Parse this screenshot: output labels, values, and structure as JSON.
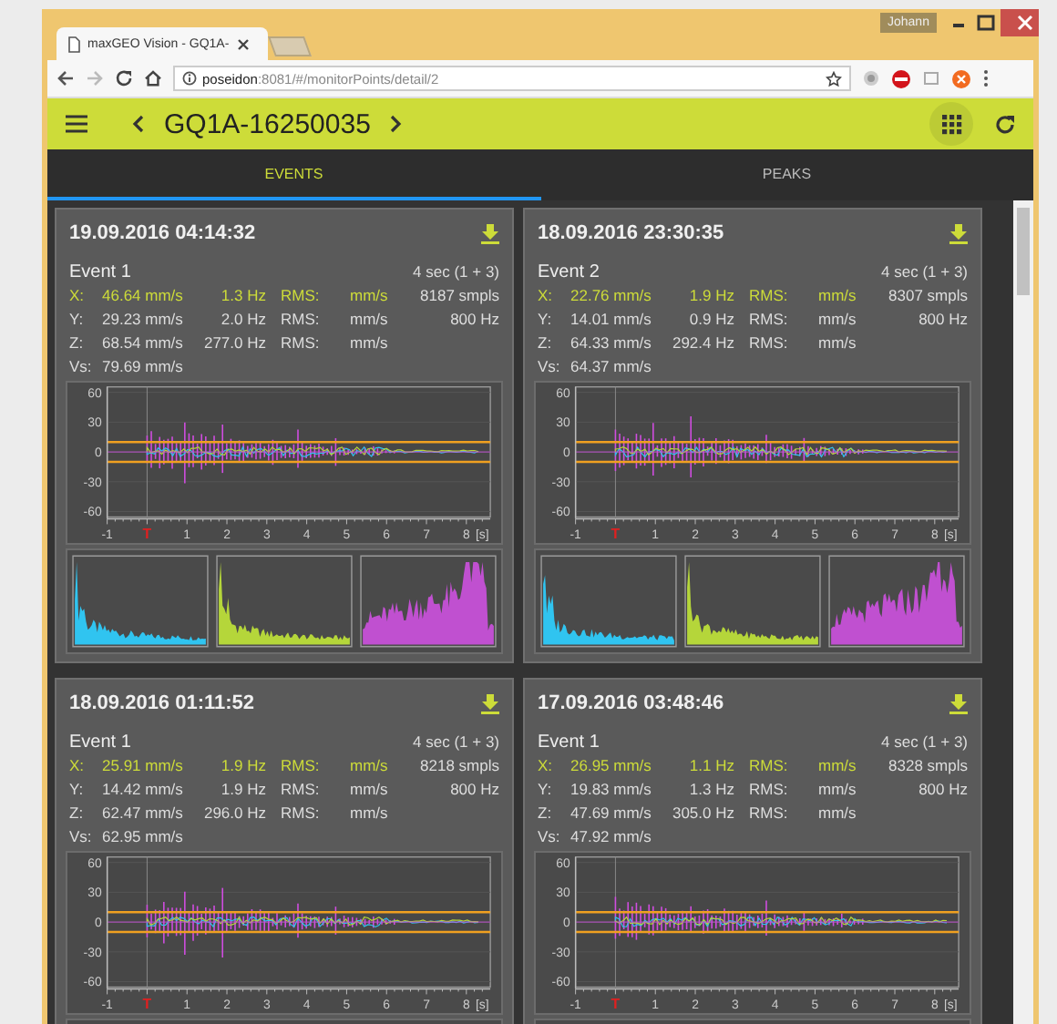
{
  "browser": {
    "tab_title": "maxGEO Vision - GQ1A-",
    "user": "Johann",
    "url_host": "poseidon",
    "url_path": ":8081/#/monitorPoints/detail/2"
  },
  "app_bar": {
    "title": "GQ1A-16250035"
  },
  "tabs": [
    {
      "label": "EVENTS",
      "selected": true
    },
    {
      "label": "PEAKS",
      "selected": false
    }
  ],
  "events": [
    {
      "timestamp": "19.09.2016 04:14:32",
      "name": "Event 1",
      "duration": "4 sec (1 + 3)",
      "axes": [
        {
          "axis": "X:",
          "velocity": "46.64 mm/s",
          "frequency": "1.3 Hz",
          "rms_label": "RMS:",
          "rms_unit": "mm/s",
          "info": "8187 smpls",
          "highlighted": true
        },
        {
          "axis": "Y:",
          "velocity": "29.23 mm/s",
          "frequency": "2.0 Hz",
          "rms_label": "RMS:",
          "rms_unit": "mm/s",
          "info": "800 Hz",
          "highlighted": false
        },
        {
          "axis": "Z:",
          "velocity": "68.54 mm/s",
          "frequency": "277.0 Hz",
          "rms_label": "RMS:",
          "rms_unit": "mm/s",
          "highlighted": false
        }
      ],
      "vs_label": "Vs:",
      "vs": "79.69 mm/s",
      "y_labels": [
        "60",
        "30",
        "0",
        "-30",
        "-60"
      ],
      "x_labels": [
        "-1",
        "T",
        "1",
        "2",
        "3",
        "4",
        "5",
        "6",
        "7",
        "8",
        "[s]"
      ]
    },
    {
      "timestamp": "18.09.2016 23:30:35",
      "name": "Event 2",
      "duration": "4 sec (1 + 3)",
      "axes": [
        {
          "axis": "X:",
          "velocity": "22.76 mm/s",
          "frequency": "1.9 Hz",
          "rms_label": "RMS:",
          "rms_unit": "mm/s",
          "info": "8307 smpls",
          "highlighted": true
        },
        {
          "axis": "Y:",
          "velocity": "14.01 mm/s",
          "frequency": "0.9 Hz",
          "rms_label": "RMS:",
          "rms_unit": "mm/s",
          "info": "800 Hz",
          "highlighted": false
        },
        {
          "axis": "Z:",
          "velocity": "64.33 mm/s",
          "frequency": "292.4 Hz",
          "rms_label": "RMS:",
          "rms_unit": "mm/s",
          "highlighted": false
        }
      ],
      "vs_label": "Vs:",
      "vs": "64.37 mm/s",
      "y_labels": [
        "60",
        "30",
        "0",
        "-30",
        "-60"
      ],
      "x_labels": [
        "-1",
        "T",
        "1",
        "2",
        "3",
        "4",
        "5",
        "6",
        "7",
        "8",
        "[s]"
      ]
    },
    {
      "timestamp": "18.09.2016 01:11:52",
      "name": "Event 1",
      "duration": "4 sec (1 + 3)",
      "axes": [
        {
          "axis": "X:",
          "velocity": "25.91 mm/s",
          "frequency": "1.9 Hz",
          "rms_label": "RMS:",
          "rms_unit": "mm/s",
          "info": "8218 smpls",
          "highlighted": true
        },
        {
          "axis": "Y:",
          "velocity": "14.42 mm/s",
          "frequency": "1.9 Hz",
          "rms_label": "RMS:",
          "rms_unit": "mm/s",
          "info": "800 Hz",
          "highlighted": false
        },
        {
          "axis": "Z:",
          "velocity": "62.47 mm/s",
          "frequency": "296.0 Hz",
          "rms_label": "RMS:",
          "rms_unit": "mm/s",
          "highlighted": false
        }
      ],
      "vs_label": "Vs:",
      "vs": "62.95 mm/s",
      "y_labels": [
        "60",
        "30",
        "0",
        "-30",
        "-60"
      ],
      "x_labels": [
        "-1",
        "T",
        "1",
        "2",
        "3",
        "4",
        "5",
        "6",
        "7",
        "8",
        "[s]"
      ]
    },
    {
      "timestamp": "17.09.2016 03:48:46",
      "name": "Event 1",
      "duration": "4 sec (1 + 3)",
      "axes": [
        {
          "axis": "X:",
          "velocity": "26.95 mm/s",
          "frequency": "1.1 Hz",
          "rms_label": "RMS:",
          "rms_unit": "mm/s",
          "info": "8328 smpls",
          "highlighted": true
        },
        {
          "axis": "Y:",
          "velocity": "19.83 mm/s",
          "frequency": "1.3 Hz",
          "rms_label": "RMS:",
          "rms_unit": "mm/s",
          "info": "800 Hz",
          "highlighted": false
        },
        {
          "axis": "Z:",
          "velocity": "47.69 mm/s",
          "frequency": "305.0 Hz",
          "rms_label": "RMS:",
          "rms_unit": "mm/s",
          "highlighted": false
        }
      ],
      "vs_label": "Vs:",
      "vs": "47.92 mm/s",
      "y_labels": [
        "60",
        "30",
        "0",
        "-30",
        "-60"
      ],
      "x_labels": [
        "-1",
        "T",
        "1",
        "2",
        "3",
        "4",
        "5",
        "6",
        "7",
        "8",
        "[s]"
      ]
    }
  ]
}
